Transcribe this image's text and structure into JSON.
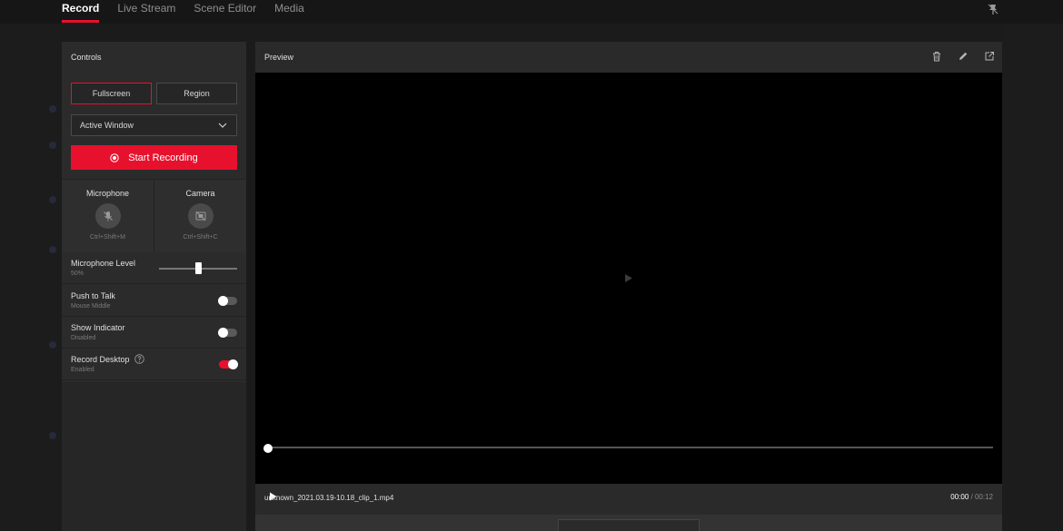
{
  "nav": {
    "tabs": [
      {
        "label": "Record",
        "active": true
      },
      {
        "label": "Live Stream",
        "active": false
      },
      {
        "label": "Scene Editor",
        "active": false
      },
      {
        "label": "Media",
        "active": false
      }
    ],
    "pin_icon": "pin-icon"
  },
  "controls": {
    "title": "Controls",
    "mode_fullscreen": "Fullscreen",
    "mode_region": "Region",
    "selected_mode": "Fullscreen",
    "capture_select": "Active Window",
    "start_recording": "Start Recording",
    "microphone": {
      "label": "Microphone",
      "shortcut": "Ctrl+Shift+M",
      "icon": "mic-off-icon"
    },
    "camera": {
      "label": "Camera",
      "shortcut": "Ctrl+Shift+C",
      "icon": "camera-off-icon"
    },
    "mic_level": {
      "title": "Microphone Level",
      "value_text": "50%",
      "value": 0.5
    },
    "push_to_talk": {
      "title": "Push to Talk",
      "sub": "Mouse Middle",
      "on": false
    },
    "show_indicator": {
      "title": "Show Indicator",
      "sub": "Disabled",
      "on": false
    },
    "record_desktop": {
      "title": "Record Desktop",
      "sub": "Enabled",
      "on": true
    }
  },
  "preview": {
    "title": "Preview",
    "icons": [
      "trash-icon",
      "pencil-icon",
      "external-link-icon"
    ],
    "time_current": "00:00",
    "time_total": "/ 00:12",
    "filename": "unknown_2021.03.19-10.18_clip_1.mp4"
  },
  "colors": {
    "accent": "#e8112d",
    "panel": "#2b2b2b",
    "background": "#1b1b1b"
  }
}
